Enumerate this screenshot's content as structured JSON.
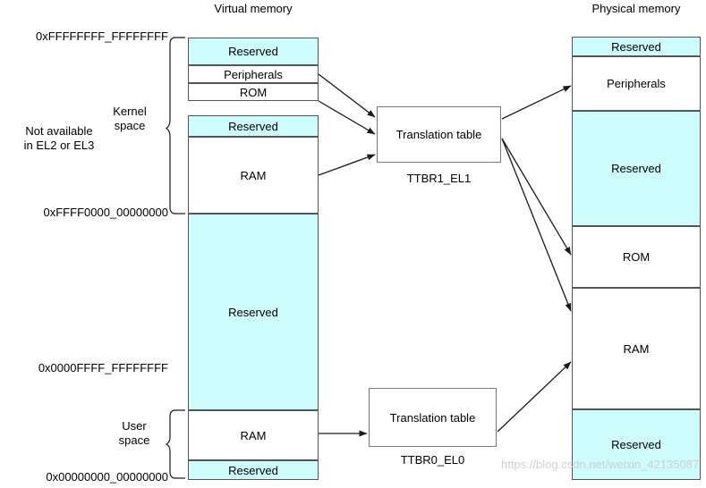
{
  "diagram": {
    "titles": {
      "virtual": "Virtual memory",
      "physical": "Physical memory"
    },
    "virtual_blocks": [
      {
        "label": "Reserved",
        "fill": "#ccfcfc"
      },
      {
        "label": "Peripherals",
        "fill": "#ffffff"
      },
      {
        "label": "ROM",
        "fill": "#ffffff"
      },
      {
        "label": "Reserved",
        "fill": "#ccfcfc"
      },
      {
        "label": "RAM",
        "fill": "#ffffff"
      },
      {
        "label": "Reserved",
        "fill": "#ccfcfc"
      },
      {
        "label": "RAM",
        "fill": "#ffffff"
      },
      {
        "label": "Reserved",
        "fill": "#ccfcfc"
      }
    ],
    "physical_blocks": [
      {
        "label": "Reserved",
        "fill": "#ccfcfc"
      },
      {
        "label": "Peripherals",
        "fill": "#ffffff"
      },
      {
        "label": "Reserved",
        "fill": "#ccfcfc"
      },
      {
        "label": "ROM",
        "fill": "#ffffff"
      },
      {
        "label": "RAM",
        "fill": "#ffffff"
      },
      {
        "label": "Reserved",
        "fill": "#ccfcfc"
      }
    ],
    "addresses": [
      {
        "text": "0xFFFFFFFF_FFFFFFFF"
      },
      {
        "text": "0xFFFF0000_00000000"
      },
      {
        "text": "0x0000FFFF_FFFFFFFF"
      },
      {
        "text": "0x00000000_00000000"
      }
    ],
    "braces": [
      {
        "label_line1": "Kernel",
        "label_line2": "space"
      },
      {
        "label_line1": "User",
        "label_line2": "space"
      }
    ],
    "notes": [
      {
        "line1": "Not available",
        "line2": "in EL2 or EL3"
      }
    ],
    "translation_tables": [
      {
        "title": "Translation table",
        "register": "TTBR1_EL1"
      },
      {
        "title": "Translation table",
        "register": "TTBR0_EL0"
      }
    ],
    "watermark": "https://blog.csdn.net/weixin_42135087",
    "colors": {
      "reserved_fill": "#ccfcfc",
      "block_stroke": "#555555",
      "arrow_stroke": "#1a1a1a",
      "watermark": "#cfcfcf"
    }
  }
}
